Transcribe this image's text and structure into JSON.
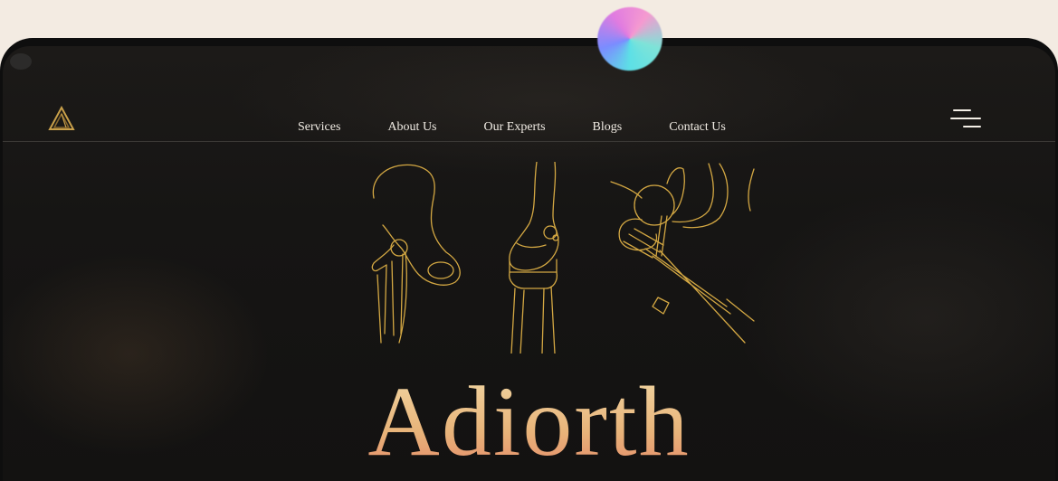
{
  "nav": {
    "links": [
      "Services",
      "About Us",
      "Our Experts",
      "Blogs",
      "Contact Us"
    ]
  },
  "hero": {
    "brand": "Adiorth"
  },
  "icons": {
    "logo": "triangle-logo-icon",
    "menu": "hamburger-menu-icon",
    "illustration": "orthopedic-joint-implants-illustration"
  },
  "colors": {
    "background": "#161514",
    "accent_gold": "#d4a843",
    "nav_text": "#f1ece4",
    "page_bg": "#f3ebe2"
  }
}
